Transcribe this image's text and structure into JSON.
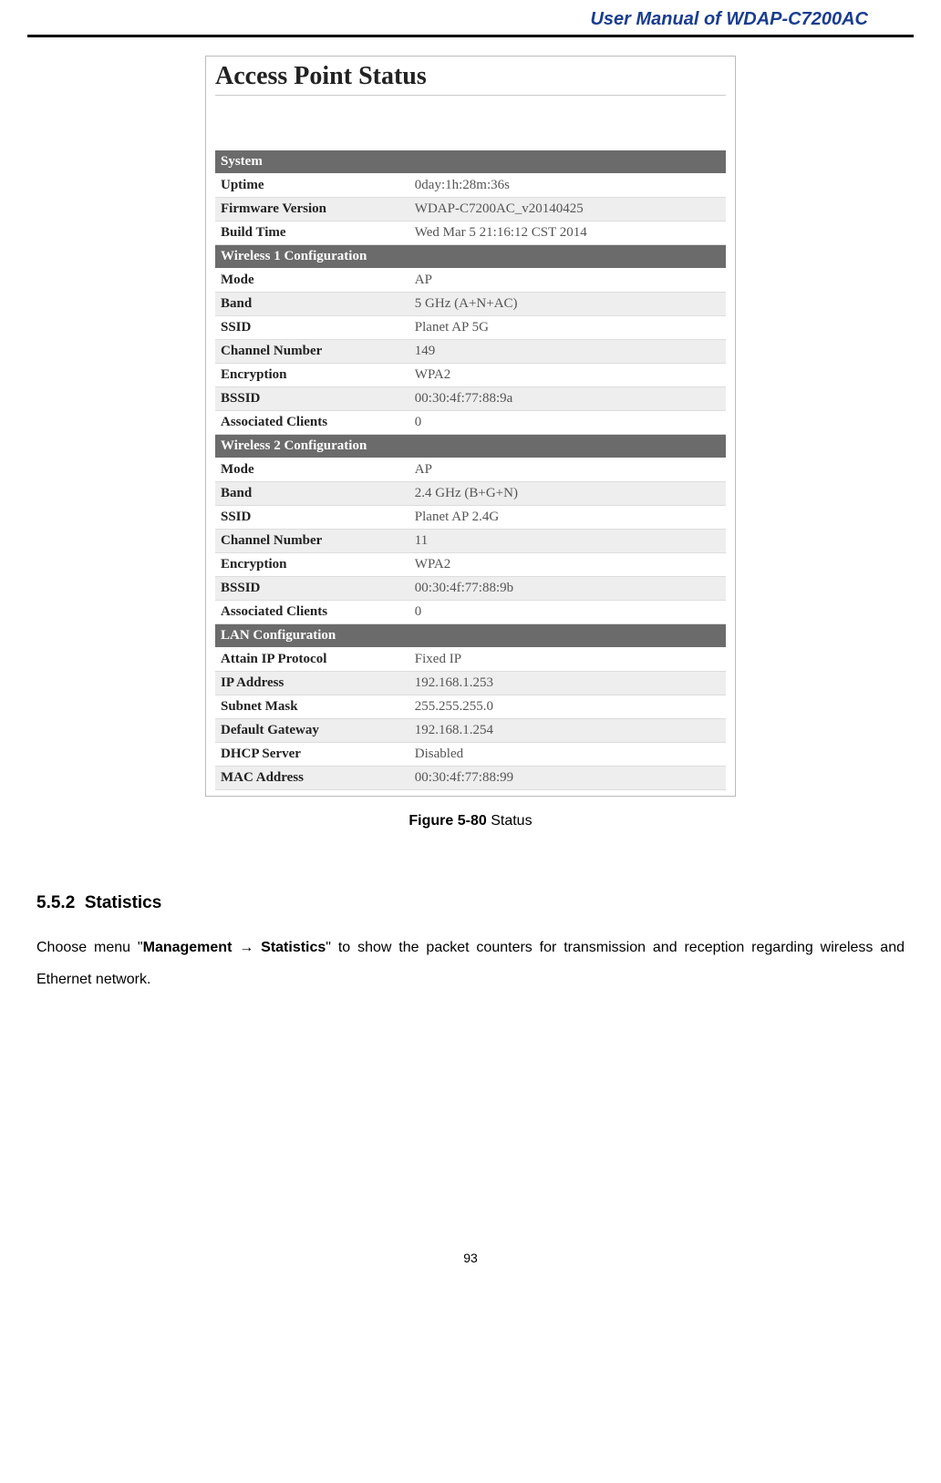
{
  "header": {
    "title": "User Manual of WDAP-C7200AC"
  },
  "status_box": {
    "title": "Access Point Status",
    "sections": [
      {
        "name": "System",
        "rows": [
          {
            "label": "Uptime",
            "value": "0day:1h:28m:36s"
          },
          {
            "label": "Firmware Version",
            "value": "WDAP-C7200AC_v20140425"
          },
          {
            "label": "Build Time",
            "value": "Wed Mar 5 21:16:12 CST 2014"
          }
        ]
      },
      {
        "name": "Wireless 1 Configuration",
        "rows": [
          {
            "label": "Mode",
            "value": "AP"
          },
          {
            "label": "Band",
            "value": "5 GHz (A+N+AC)"
          },
          {
            "label": "SSID",
            "value": "Planet AP 5G"
          },
          {
            "label": "Channel Number",
            "value": "149"
          },
          {
            "label": "Encryption",
            "value": "WPA2"
          },
          {
            "label": "BSSID",
            "value": "00:30:4f:77:88:9a"
          },
          {
            "label": "Associated Clients",
            "value": "0"
          }
        ]
      },
      {
        "name": "Wireless 2 Configuration",
        "rows": [
          {
            "label": "Mode",
            "value": "AP"
          },
          {
            "label": "Band",
            "value": "2.4 GHz (B+G+N)"
          },
          {
            "label": "SSID",
            "value": "Planet AP 2.4G"
          },
          {
            "label": "Channel Number",
            "value": "11"
          },
          {
            "label": "Encryption",
            "value": "WPA2"
          },
          {
            "label": "BSSID",
            "value": "00:30:4f:77:88:9b"
          },
          {
            "label": "Associated Clients",
            "value": "0"
          }
        ]
      },
      {
        "name": "LAN Configuration",
        "rows": [
          {
            "label": "Attain IP Protocol",
            "value": "Fixed IP"
          },
          {
            "label": "IP Address",
            "value": "192.168.1.253"
          },
          {
            "label": "Subnet Mask",
            "value": "255.255.255.0"
          },
          {
            "label": "Default Gateway",
            "value": "192.168.1.254"
          },
          {
            "label": "DHCP Server",
            "value": "Disabled"
          },
          {
            "label": "MAC Address",
            "value": "00:30:4f:77:88:99"
          }
        ]
      }
    ]
  },
  "caption": {
    "bold": "Figure 5-80",
    "rest": " Status"
  },
  "section": {
    "number": "5.5.2",
    "title": "Statistics"
  },
  "body": {
    "pre": "Choose menu \"",
    "b1": "Management",
    "arrow": " → ",
    "b2": "Statistics",
    "post": "\" to show the packet counters for transmission and reception regarding wireless and Ethernet network."
  },
  "page_number": "93"
}
